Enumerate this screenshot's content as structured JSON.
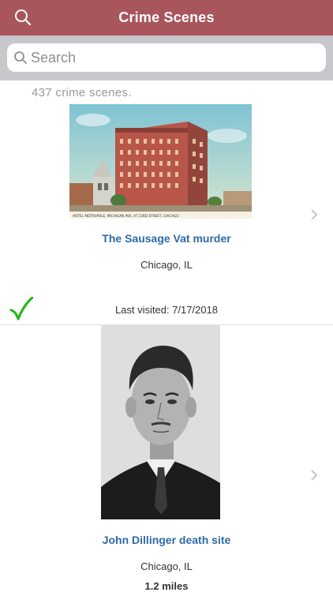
{
  "nav": {
    "title": "Crime Scenes",
    "search_icon": "search-icon"
  },
  "search": {
    "placeholder": "Search",
    "value": ""
  },
  "list": {
    "count_text": "437 crime scenes.",
    "items": [
      {
        "title": "The Sausage Vat murder",
        "location": "Chicago, IL",
        "visited_text": "Last visited: 7/17/2018",
        "visited": true,
        "image_caption": "HOTEL METROPOLE, MICHIGAN AVE. AT 23RD STREET, CHICAGO"
      },
      {
        "title": "John Dillinger death site",
        "location": "Chicago, IL",
        "distance": "1.2 miles"
      }
    ]
  },
  "colors": {
    "nav_bg": "#a9555c",
    "link": "#2c6aa8",
    "check": "#2bb520"
  }
}
